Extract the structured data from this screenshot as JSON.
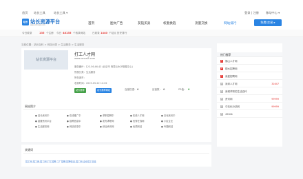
{
  "topbar": {
    "home": "首页",
    "collect": "站长工具",
    "tools": "站长工具 ▾",
    "login": "登录 | 注册",
    "mobile": "移动中心 ▾"
  },
  "header": {
    "logo_mark": "站长",
    "logo_text": "站长资源平台",
    "logo_sub": "www.chinaz.com",
    "nav": [
      "首页",
      "图文广告",
      "友链买卖",
      "权重换链",
      "流量交换",
      "网站排行"
    ],
    "login_btn": "免费/交易 ▸"
  },
  "stats": [
    {
      "label": "今日收录",
      "value": "135",
      "tail": "个注册"
    },
    {
      "label": "今日",
      "value": "48135",
      "tail": "个收录网站"
    },
    {
      "label": "已收录",
      "value": "1440",
      "tail": "个站点 历史排行"
    }
  ],
  "crumb": "当前位置：站长百科 > 网站分类 > 生活服务 > 生活服务",
  "site": {
    "thumb": "站长资源平台",
    "name": "打工人才网",
    "domain": "www.rencai5.com",
    "ip": "服务器IP：123.56.46.43 (北京市 阿里云BGP数据中心)",
    "category": "所属分类：生活服务",
    "city": "所在城市：",
    "date": "收录时间：2019-05-22 12:02",
    "pills": [
      "站长推荐",
      "站长推荐网站"
    ],
    "metrics": [
      {
        "label": "百度权重：",
        "value": "0"
      },
      {
        "label": "反链数：",
        "value": "0"
      },
      {
        "label": "PR值：",
        "value": "0"
      }
    ]
  },
  "sidebar": {
    "title": "热门推荐",
    "items": [
      {
        "rank": "1",
        "label": "佛山人才网",
        "value": ""
      },
      {
        "rank": "2",
        "label": "顺水招聘网",
        "value": ""
      },
      {
        "rank": "3",
        "label": "我爱招聘网",
        "value": ""
      },
      {
        "rank": "4",
        "label": "深圳人才网",
        "value": "31647"
      },
      {
        "rank": "5",
        "label": "我城求职的生活百科",
        "value": ""
      },
      {
        "rank": "6",
        "label": "资讯网",
        "value": "99999"
      },
      {
        "rank": "7",
        "label": "中石化分站网",
        "value": "99999"
      },
      {
        "rank": "8",
        "label": "4564k",
        "value": ""
      }
    ]
  },
  "intro": {
    "title": "网站简介",
    "cells": [
      [
        "● 站长资讯中",
        "● 在线推广中",
        "● 求职招聘中",
        "● 在线人才网",
        "● 日化资讯中"
      ],
      [
        "● 重要资讯平台",
        "● 招聘信息中",
        "● 发布求职网",
        "● 优秀在线网",
        "● 小区企业"
      ],
      [
        "● 生活服务网",
        "● 网站收录中",
        "● 综合资讯网",
        "● 优质网站",
        "● 专题网站"
      ]
    ]
  },
  "keywords": {
    "title": "关键词",
    "text": "招工网,招工网,招工网,打工招聘,工厂招聘,招聘信息,招工网,企业招工信息"
  },
  "colors": {
    "accent": "#2a84e3",
    "alert": "#e53935",
    "green": "#43a047"
  }
}
